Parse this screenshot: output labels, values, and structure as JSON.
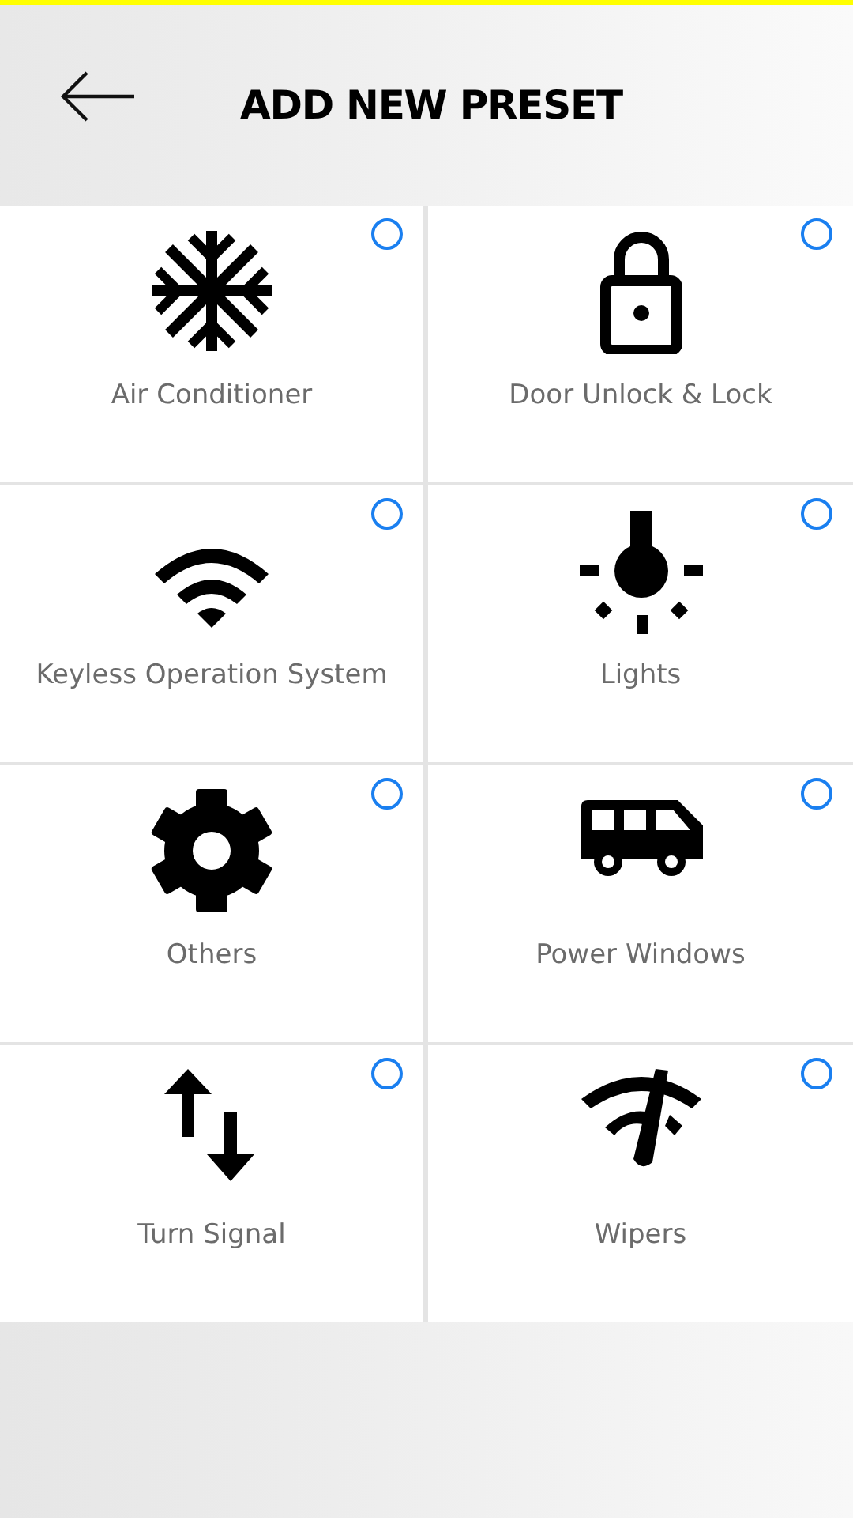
{
  "header": {
    "title": "ADD NEW PRESET"
  },
  "presets": [
    {
      "label": "Air Conditioner",
      "selected": false
    },
    {
      "label": "Door Unlock & Lock",
      "selected": false
    },
    {
      "label": "Keyless Operation System",
      "selected": false
    },
    {
      "label": "Lights",
      "selected": false
    },
    {
      "label": "Others",
      "selected": false
    },
    {
      "label": "Power Windows",
      "selected": false
    },
    {
      "label": "Turn Signal",
      "selected": false
    },
    {
      "label": "Wipers",
      "selected": false
    }
  ]
}
